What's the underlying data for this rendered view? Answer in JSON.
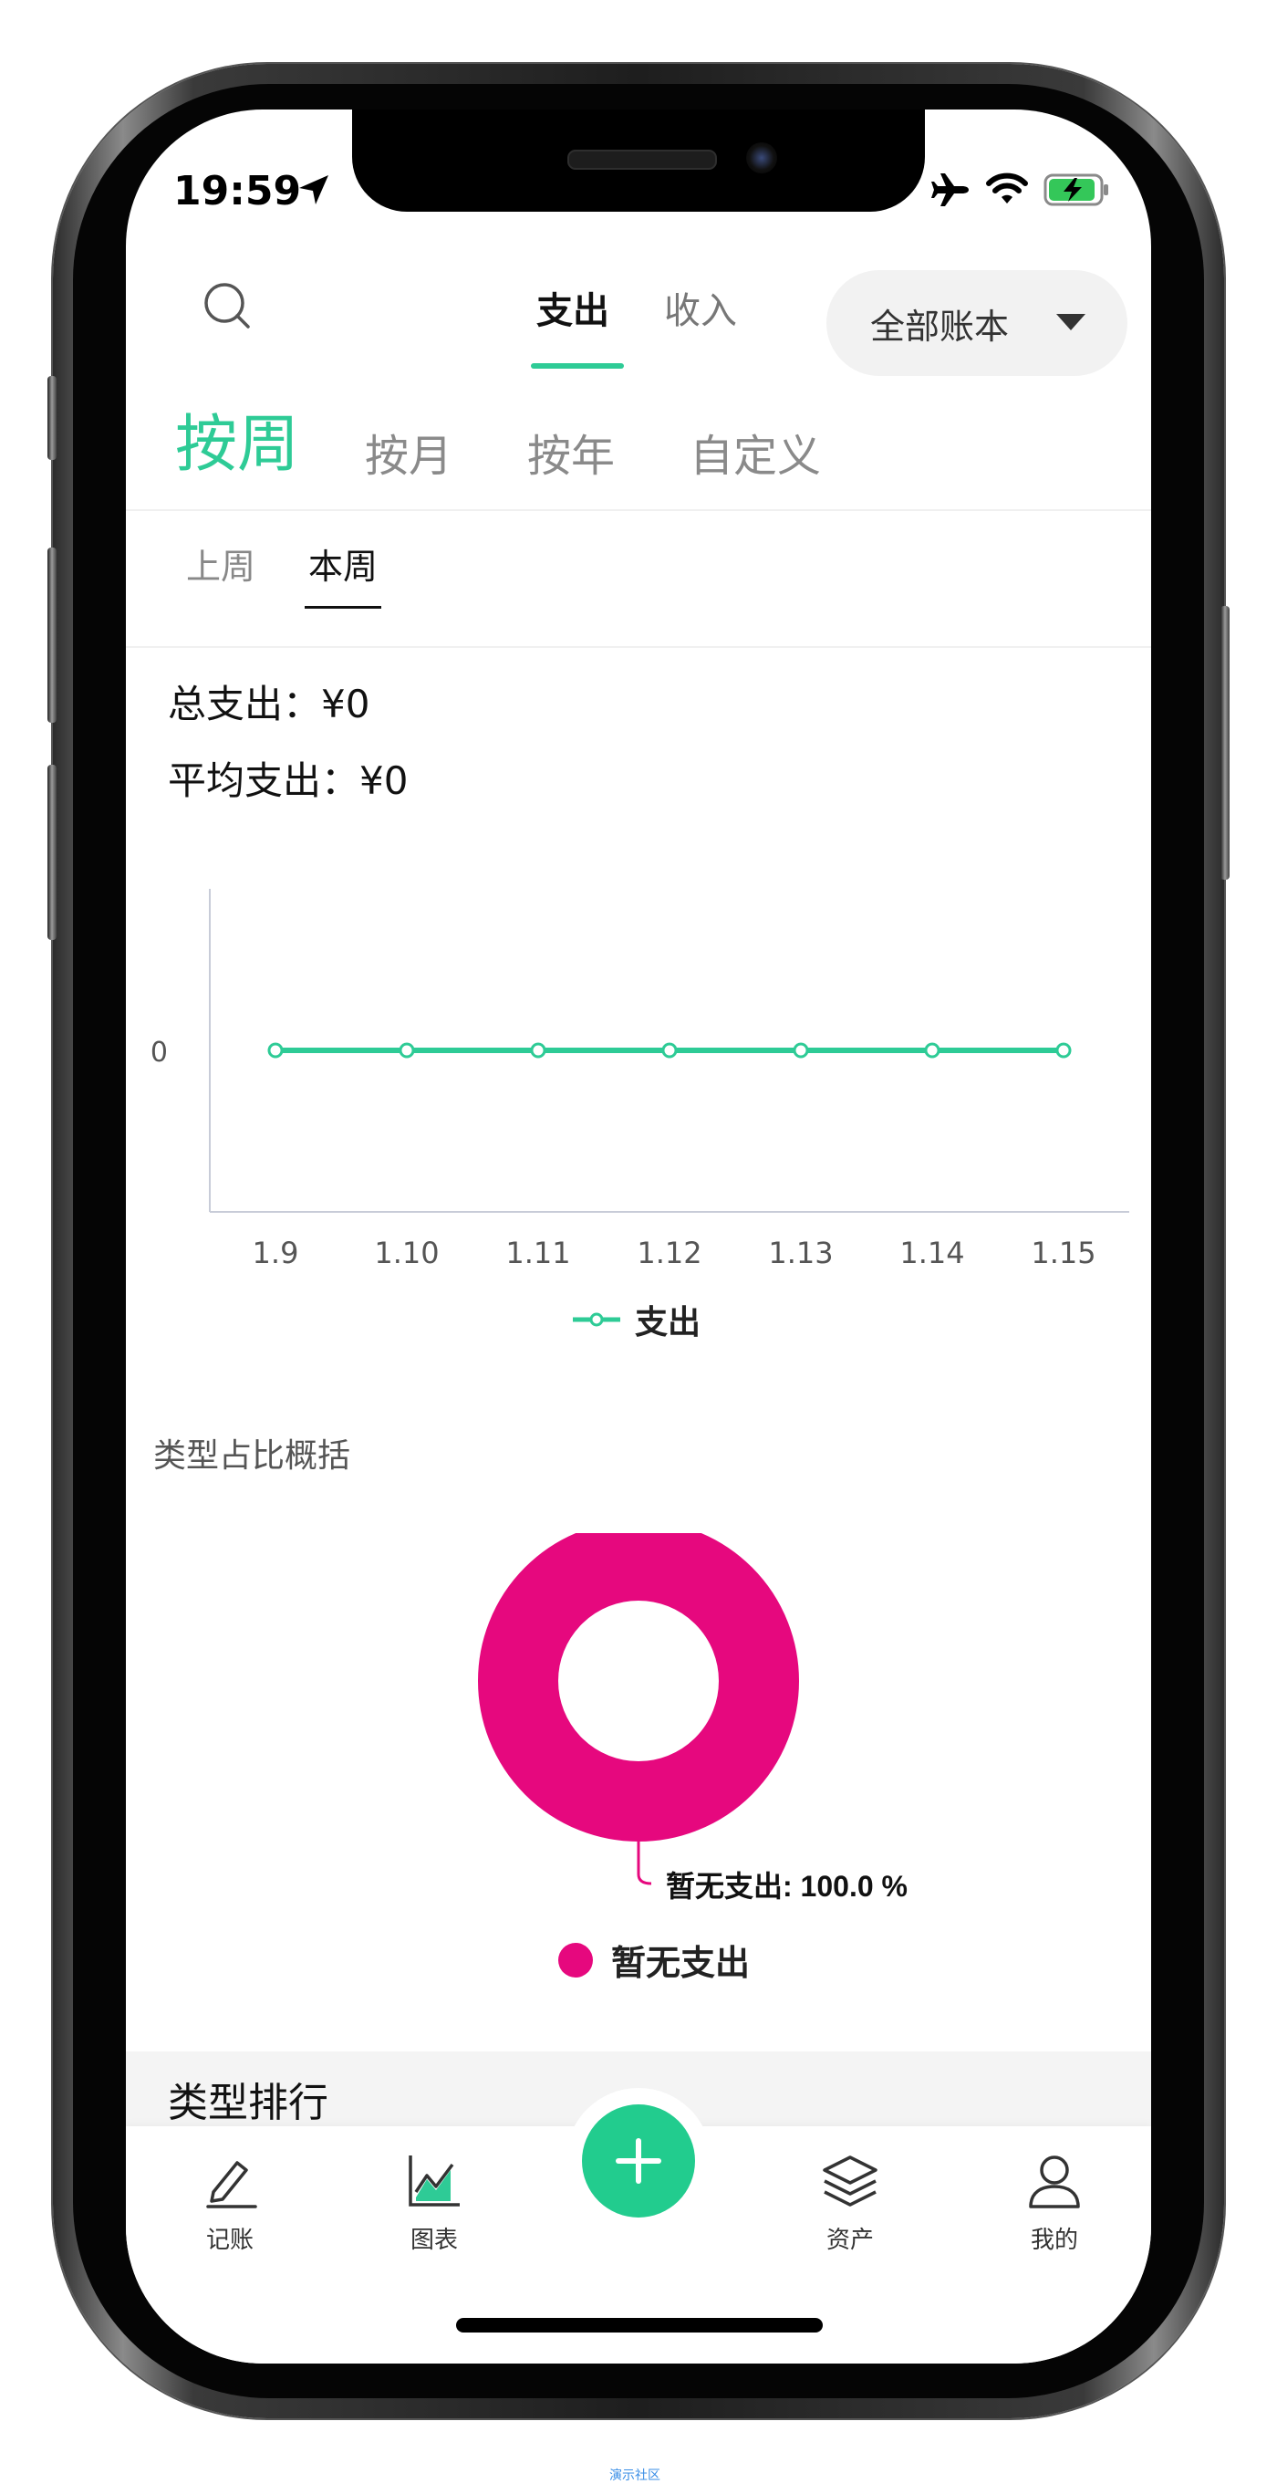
{
  "status": {
    "time": "19:59"
  },
  "header": {
    "tabs": [
      {
        "label": "支出"
      },
      {
        "label": "收入"
      }
    ],
    "account": "全部账本"
  },
  "period_tabs": [
    {
      "label": "按周"
    },
    {
      "label": "按月"
    },
    {
      "label": "按年"
    },
    {
      "label": "自定义"
    }
  ],
  "week_tabs": [
    {
      "label": "上周"
    },
    {
      "label": "本周"
    }
  ],
  "summary": {
    "total": "总支出：¥0",
    "average": "平均支出：¥0"
  },
  "chart_data": [
    {
      "type": "line",
      "x": [
        "1.9",
        "1.10",
        "1.11",
        "1.12",
        "1.13",
        "1.14",
        "1.15"
      ],
      "series": [
        {
          "name": "支出",
          "values": [
            0,
            0,
            0,
            0,
            0,
            0,
            0
          ],
          "color": "#2ecb96"
        }
      ],
      "y_tick_labels": [
        "0"
      ],
      "legend": "bottom-center",
      "grid": false
    },
    {
      "type": "pie",
      "title": "类型占比概括",
      "categories": [
        "暂无支出"
      ],
      "values": [
        100.0
      ],
      "colors": [
        "#e6087e"
      ],
      "data_label": "暂无支出: 100.0 %",
      "legend": "bottom-center"
    }
  ],
  "ranking": {
    "title": "类型排行"
  },
  "nav": [
    {
      "label": "记账"
    },
    {
      "label": "图表"
    },
    {
      "label": "资产"
    },
    {
      "label": "我的"
    }
  ],
  "colors": {
    "accent": "#2ecb96",
    "donut": "#e6087e",
    "fab": "#22cc8e"
  },
  "watermark": "演示社区"
}
